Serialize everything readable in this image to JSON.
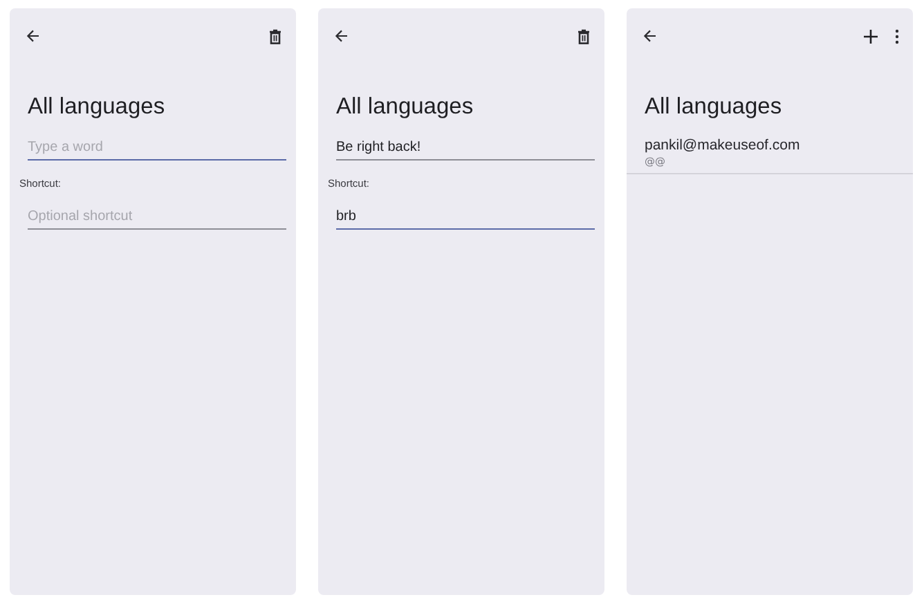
{
  "screens": [
    {
      "kind": "editor",
      "actions": [
        {
          "kind": "delete"
        }
      ],
      "title": "All languages",
      "word": {
        "placeholder": "Type a word",
        "focused": true
      },
      "shortcut_label": "Shortcut:",
      "shortcut": {
        "placeholder": "Optional shortcut",
        "focused": false
      }
    },
    {
      "kind": "editor",
      "actions": [
        {
          "kind": "delete"
        }
      ],
      "title": "All languages",
      "word": {
        "value": "Be right back!",
        "focused": false
      },
      "shortcut_label": "Shortcut:",
      "shortcut": {
        "value": "brb",
        "focused": true
      }
    },
    {
      "kind": "list",
      "actions": [
        {
          "kind": "add"
        },
        {
          "kind": "more"
        }
      ],
      "title": "All languages",
      "entries": [
        {
          "word": "pankil@makeuseof.com",
          "shortcut": "@@"
        }
      ]
    }
  ]
}
